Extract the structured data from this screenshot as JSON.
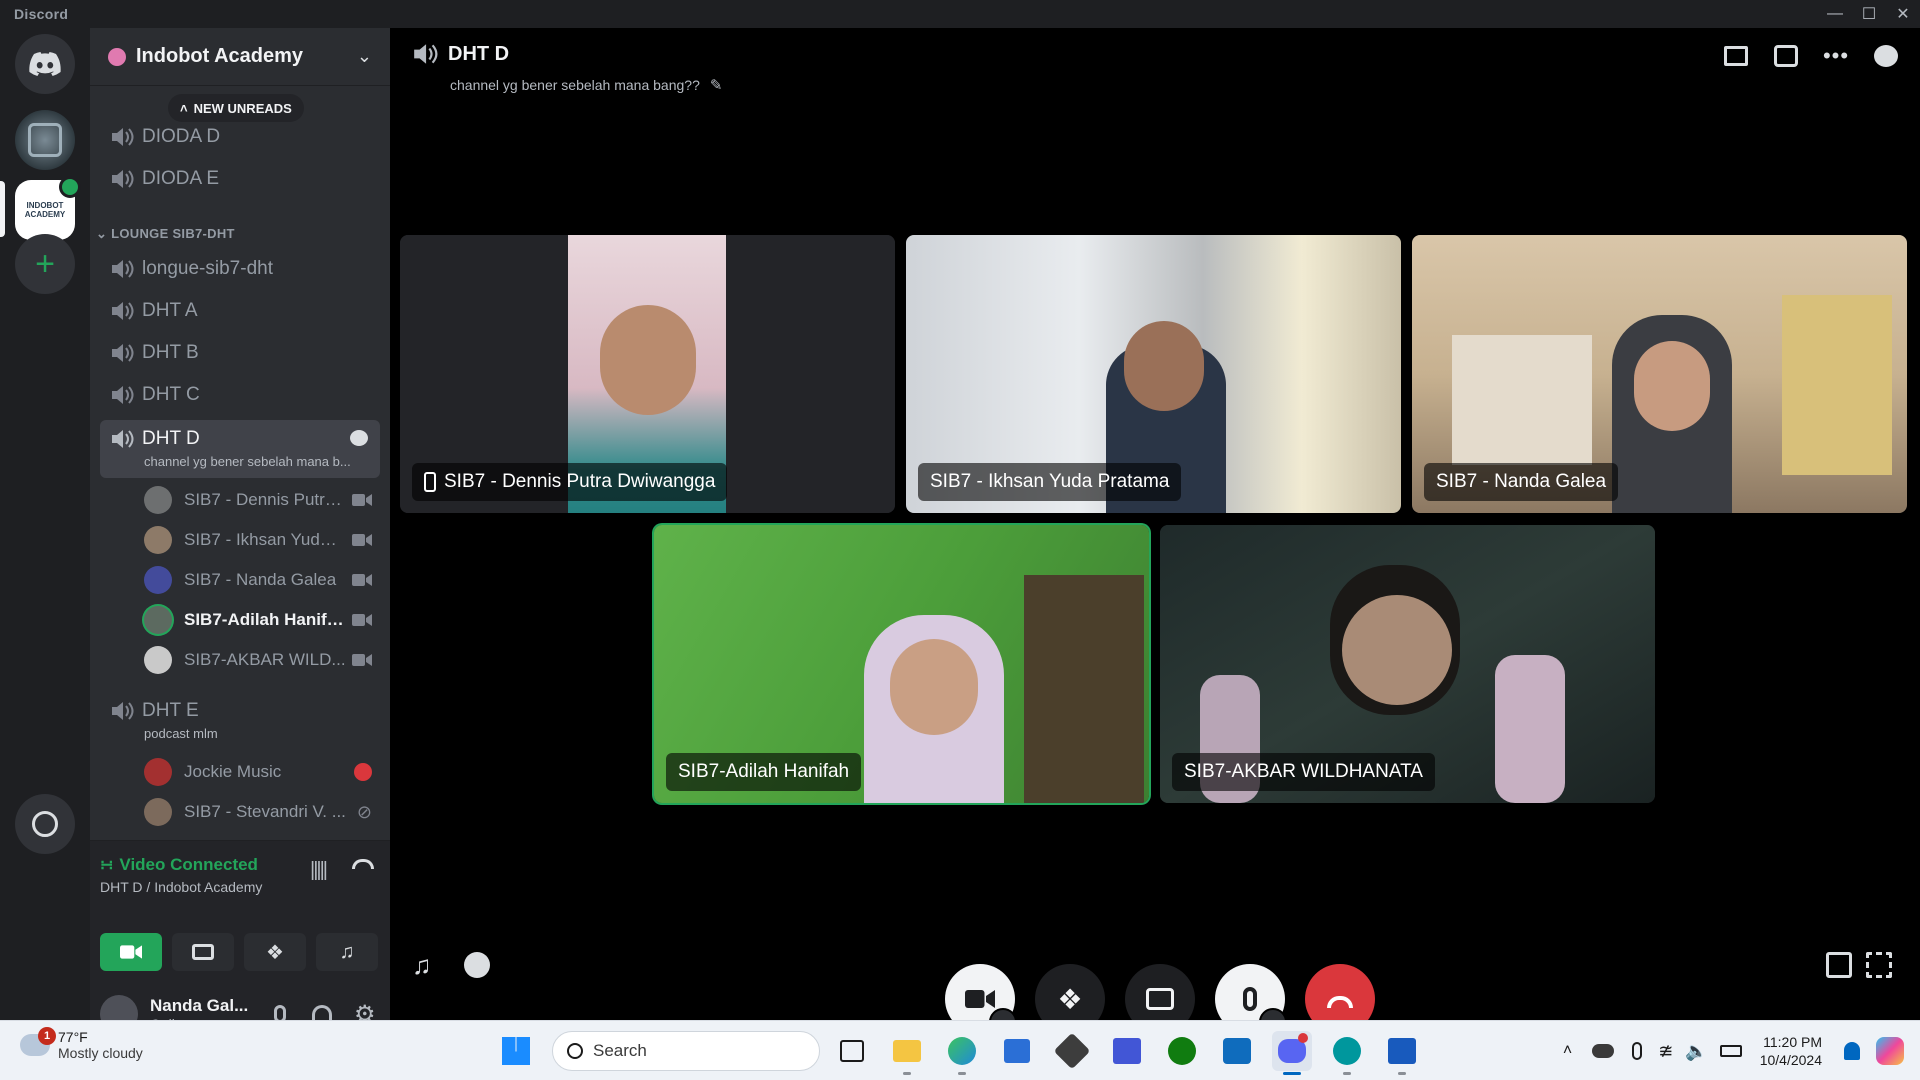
{
  "window": {
    "app_name": "Discord",
    "controls": [
      "minimize",
      "maximize",
      "close"
    ]
  },
  "server": {
    "name": "Indobot Academy"
  },
  "sidebar": {
    "new_unreads_label": "NEW UNREADS",
    "top_channels": [
      {
        "label": "DIODA D"
      },
      {
        "label": "DIODA E"
      }
    ],
    "category": "LOUNGE SIB7-DHT",
    "channels": [
      {
        "label": "longue-sib7-dht"
      },
      {
        "label": "DHT A"
      },
      {
        "label": "DHT B"
      },
      {
        "label": "DHT C"
      }
    ],
    "active_channel": {
      "label": "DHT D",
      "topic": "channel yg bener sebelah mana b..."
    },
    "dht_d_members": [
      {
        "name": "SIB7 - Dennis Putra...",
        "speaking": false
      },
      {
        "name": "SIB7 - Ikhsan Yuda ...",
        "speaking": false
      },
      {
        "name": "SIB7 - Nanda Galea",
        "speaking": false
      },
      {
        "name": "SIB7-Adilah Hanifah",
        "speaking": true
      },
      {
        "name": "SIB7-AKBAR WILD...",
        "speaking": false
      }
    ],
    "dht_e": {
      "label": "DHT E",
      "topic": "podcast mlm"
    },
    "dht_e_members": [
      {
        "name": "Jockie Music"
      },
      {
        "name": "SIB7 - Stevandri V. ..."
      }
    ]
  },
  "voice_panel": {
    "status": "Video Connected",
    "location": "DHT D / Indobot Academy"
  },
  "user_panel": {
    "name": "Nanda Gal...",
    "status": "Online"
  },
  "stage": {
    "title": "DHT D",
    "topic": "channel yg bener sebelah mana bang??",
    "tiles": [
      {
        "name": "SIB7 - Dennis Putra Dwiwangga",
        "mobile": true
      },
      {
        "name": "SIB7 - Ikhsan Yuda Pratama"
      },
      {
        "name": "SIB7 - Nanda Galea"
      },
      {
        "name": "SIB7-Adilah Hanifah"
      },
      {
        "name": "SIB7-AKBAR WILDHANATA"
      }
    ]
  },
  "taskbar": {
    "weather_temp": "77°F",
    "weather_desc": "Mostly cloudy",
    "weather_badge": "1",
    "search_placeholder": "Search",
    "time": "11:20 PM",
    "date": "10/4/2024"
  },
  "colors": {
    "accent_green": "#23a55a",
    "danger_red": "#da373c",
    "sidebar_bg": "#2b2d31",
    "rail_bg": "#1e1f22"
  }
}
